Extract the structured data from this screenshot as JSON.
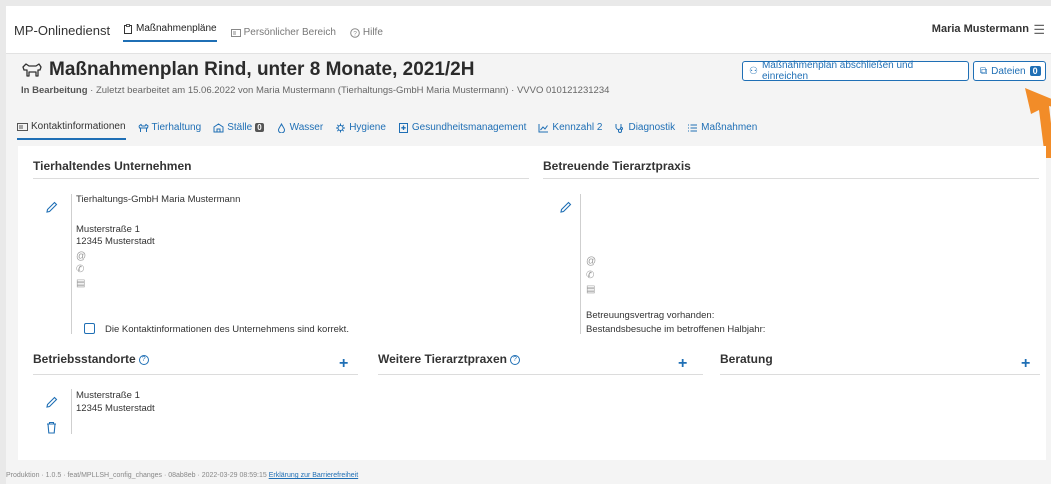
{
  "topbar": {
    "brand": "MP-Onlinedienst",
    "nav": [
      {
        "label": "Maßnahmenpläne",
        "active": true
      },
      {
        "label": "Persönlicher Bereich",
        "active": false
      },
      {
        "label": "Hilfe",
        "active": false
      }
    ],
    "user": "Maria Mustermann"
  },
  "header": {
    "title": "Maßnahmenplan Rind, unter 8 Monate, 2021/2H",
    "status": "In Bearbeitung",
    "subtitle_rest": " · Zuletzt bearbeitet am 15.06.2022 von Maria Mustermann (Tierhaltungs-GmbH Maria Mustermann) · VVVO 010121231234",
    "submit_label": "Maßnahmenplan abschließen und einreichen",
    "files_label": "Dateien",
    "files_count": "0"
  },
  "tabs": [
    {
      "label": "Kontaktinformationen",
      "active": true
    },
    {
      "label": "Tierhaltung"
    },
    {
      "label": "Ställe",
      "badge": "0"
    },
    {
      "label": "Wasser"
    },
    {
      "label": "Hygiene"
    },
    {
      "label": "Gesundheitsmanagement"
    },
    {
      "label": "Kennzahl 2"
    },
    {
      "label": "Diagnostik"
    },
    {
      "label": "Maßnahmen"
    }
  ],
  "company": {
    "heading": "Tierhaltendes Unternehmen",
    "name": "Tierhaltungs-GmbH Maria Mustermann",
    "street": "Musterstraße 1",
    "city": "12345 Musterstadt",
    "confirm_label": "Die Kontaktinformationen des Unternehmens sind korrekt."
  },
  "vet": {
    "heading": "Betreuende Tierarztpraxis",
    "contract_label": "Betreuungsvertrag vorhanden:",
    "visits_label": "Bestandsbesuche im betroffenen Halbjahr:"
  },
  "locations": {
    "heading": "Betriebsstandorte",
    "street": "Musterstraße 1",
    "city": "12345 Musterstadt"
  },
  "other_vets": {
    "heading": "Weitere Tierarztpraxen"
  },
  "consulting": {
    "heading": "Beratung"
  },
  "footer": {
    "text": "Produktion · 1.0.5 · feat/MPLLSH_config_changes · 08ab8eb · 2022-03-29 08:59:15 ",
    "link": "Erklärung zur Barrierefreiheit"
  },
  "colors": {
    "accent": "#1f6fb5",
    "arrow": "#f28c28"
  }
}
